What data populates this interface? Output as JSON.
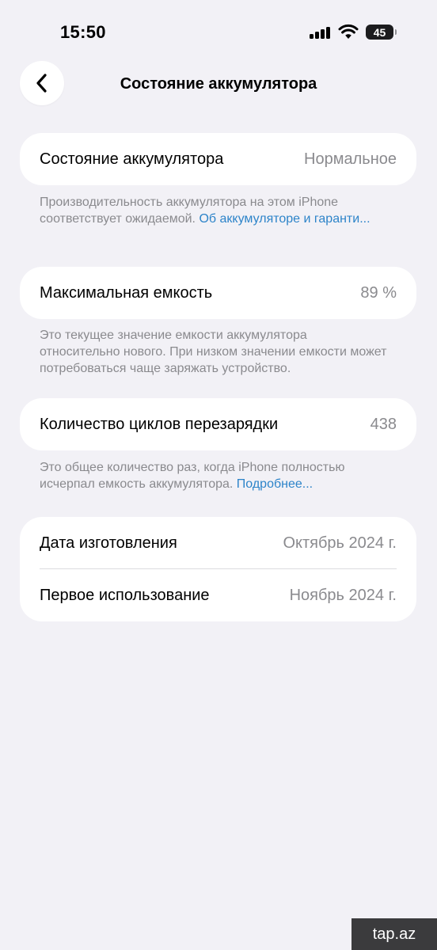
{
  "status_bar": {
    "time": "15:50",
    "battery_level": "45",
    "icons": [
      "cellular-signal-icon",
      "wifi-icon",
      "battery-icon"
    ]
  },
  "nav": {
    "back_icon": "chevron-left-icon",
    "title": "Состояние аккумулятора"
  },
  "battery_health": {
    "label": "Состояние аккумулятора",
    "value": "Нормальное",
    "footnote_text": "Производительность аккумулятора на этом iPhone соответствует ожидаемой. ",
    "footnote_link": "Об аккумуляторе и гаранти..."
  },
  "max_capacity": {
    "label": "Максимальная емкость",
    "value": "89 %",
    "footnote_text": "Это текущее значение емкости аккумулятора относительно нового. При низком значении емкости может потребоваться чаще заряжать устройство."
  },
  "cycle_count": {
    "label": "Количество циклов перезарядки",
    "value": "438",
    "footnote_text": "Это общее количество раз, когда iPhone полностью исчерпал емкость аккумулятора. ",
    "footnote_link": "Подробнее..."
  },
  "dates": {
    "manufacture_label": "Дата изготовления",
    "manufacture_value": "Октябрь 2024 г.",
    "first_use_label": "Первое использование",
    "first_use_value": "Ноябрь 2024 г."
  },
  "watermark": "tap.az",
  "colors": {
    "background": "#f2f1f6",
    "card": "#ffffff",
    "secondary_text": "#8a8a8e",
    "link": "#2d84c9"
  }
}
